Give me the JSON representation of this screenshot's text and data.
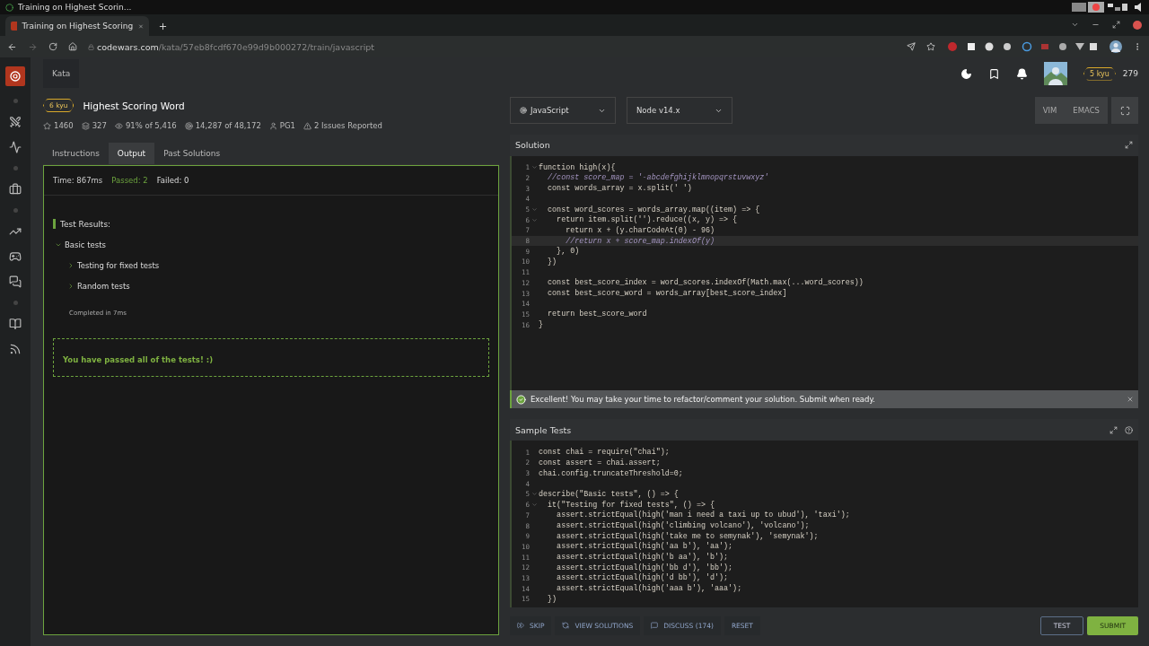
{
  "os_bar": {
    "title": "Training on Highest Scorin..."
  },
  "browser": {
    "tab_title": "Training on Highest Scoring",
    "url_host": "codewars.com",
    "url_path": "/kata/57eb8fcdf670e99d9b000272/train/javascript"
  },
  "nav": {
    "breadcrumb": "Kata",
    "rank": "5 kyu",
    "honor": "279"
  },
  "kata": {
    "rank": "6 kyu",
    "title": "Highest Scoring Word",
    "stats": [
      {
        "kind": "star",
        "text": "1460"
      },
      {
        "kind": "collection",
        "text": "327"
      },
      {
        "kind": "satisfaction",
        "text": "91% of 5,416"
      },
      {
        "kind": "completed",
        "text": "14,287 of 48,172"
      },
      {
        "kind": "author",
        "text": "PG1"
      },
      {
        "kind": "issues",
        "text": "2 Issues Reported"
      }
    ]
  },
  "tabs": [
    {
      "label": "Instructions",
      "selected": false
    },
    {
      "label": "Output",
      "selected": true
    },
    {
      "label": "Past Solutions",
      "selected": false
    }
  ],
  "output": {
    "time": "Time: 867ms",
    "passed": "Passed: 2",
    "failed": "Failed: 0",
    "heading": "Test Results:",
    "tree": [
      {
        "label": "Basic tests",
        "expanded": true,
        "children": [
          {
            "label": "Testing for fixed tests",
            "expanded": false
          },
          {
            "label": "Random tests",
            "expanded": false
          }
        ]
      }
    ],
    "completed": "Completed in 7ms",
    "message": "You have passed all of the tests! :)"
  },
  "selectors": [
    {
      "label": "JavaScript",
      "kind": "language"
    },
    {
      "label": "Node v14.x",
      "kind": "version"
    }
  ],
  "modes": [
    "VIM",
    "EMACS"
  ],
  "solution": {
    "title": "Solution",
    "lines": [
      {
        "number": "1",
        "text": "function high(x){",
        "kind": "code",
        "fold": true,
        "active": false
      },
      {
        "number": "2",
        "text": "  //const score_map = '-abcdefghijklmnopqrstuvwxyz'",
        "kind": "comment",
        "fold": false,
        "active": false
      },
      {
        "number": "3",
        "text": "  const words_array = x.split(' ')",
        "kind": "code",
        "fold": false,
        "active": false
      },
      {
        "number": "4",
        "fold": false,
        "active": false
      },
      {
        "number": "5",
        "text": "  const word_scores = words_array.map((item) => {",
        "kind": "code",
        "fold": true,
        "active": false
      },
      {
        "number": "6",
        "text": "    return item.split('').reduce((x, y) => {",
        "kind": "code",
        "fold": true,
        "active": false
      },
      {
        "number": "7",
        "text": "      return x + (y.charCodeAt(0) - 96)",
        "kind": "code",
        "fold": false,
        "active": false
      },
      {
        "number": "8",
        "text": "      //return x + score_map.indexOf(y)",
        "kind": "comment",
        "fold": false,
        "active": true
      },
      {
        "number": "9",
        "text": "    }, 0)",
        "kind": "code",
        "fold": false,
        "active": false
      },
      {
        "number": "10",
        "text": "  })",
        "kind": "code",
        "fold": false,
        "active": false
      },
      {
        "number": "11",
        "fold": false,
        "active": false
      },
      {
        "number": "12",
        "text": "  const best_score_index = word_scores.indexOf(Math.max(...word_scores))",
        "kind": "code",
        "fold": false,
        "active": false
      },
      {
        "number": "13",
        "text": "  const best_score_word = words_array[best_score_index]",
        "kind": "code",
        "fold": false,
        "active": false
      },
      {
        "number": "14",
        "fold": false,
        "active": false
      },
      {
        "number": "15",
        "text": "  return best_score_word",
        "kind": "code",
        "fold": false,
        "active": false
      },
      {
        "number": "16",
        "text": "}",
        "kind": "code",
        "fold": false,
        "active": false
      }
    ]
  },
  "notice": "Excellent! You may take your time to refactor/comment your solution. Submit when ready.",
  "sample_tests": {
    "title": "Sample Tests",
    "lines": [
      {
        "number": "1",
        "text": "const chai = require(\"chai\");",
        "fold": false
      },
      {
        "number": "2",
        "text": "const assert = chai.assert;",
        "fold": false
      },
      {
        "number": "3",
        "text": "chai.config.truncateThreshold=0;",
        "fold": false
      },
      {
        "number": "4",
        "fold": false
      },
      {
        "number": "5",
        "text": "describe(\"Basic tests\", () => {",
        "fold": true
      },
      {
        "number": "6",
        "text": "  it(\"Testing for fixed tests\", () => {",
        "fold": true
      },
      {
        "number": "7",
        "text": "    assert.strictEqual(high('man i need a taxi up to ubud'), 'taxi');",
        "fold": false
      },
      {
        "number": "8",
        "text": "    assert.strictEqual(high('climbing volcano'), 'volcano');",
        "fold": false
      },
      {
        "number": "9",
        "text": "    assert.strictEqual(high('take me to semynak'), 'semynak');",
        "fold": false
      },
      {
        "number": "10",
        "text": "    assert.strictEqual(high('aa b'), 'aa');",
        "fold": false
      },
      {
        "number": "11",
        "text": "    assert.strictEqual(high('b aa'), 'b');",
        "fold": false
      },
      {
        "number": "12",
        "text": "    assert.strictEqual(high('bb d'), 'bb');",
        "fold": false
      },
      {
        "number": "13",
        "text": "    assert.strictEqual(high('d bb'), 'd');",
        "fold": false
      },
      {
        "number": "14",
        "text": "    assert.strictEqual(high('aaa b'), 'aaa');",
        "fold": false
      },
      {
        "number": "15",
        "text": "  })",
        "fold": false
      }
    ]
  },
  "actions": [
    {
      "label": "SKIP",
      "kind": "skip"
    },
    {
      "label": "VIEW SOLUTIONS",
      "kind": "solutions"
    },
    {
      "label": "DISCUSS (174)",
      "kind": "discuss"
    },
    {
      "label": "RESET",
      "kind": "reset"
    }
  ],
  "test_button": "TEST",
  "submit_button": "SUBMIT"
}
